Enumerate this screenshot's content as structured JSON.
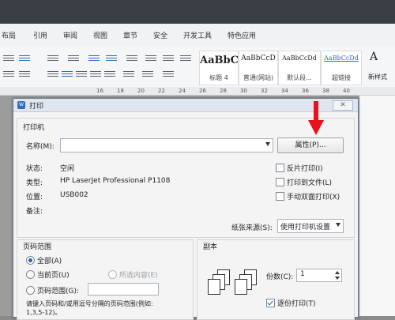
{
  "ribbon_tabs": [
    "布局",
    "引用",
    "审阅",
    "视图",
    "章节",
    "安全",
    "开发工具",
    "特色应用"
  ],
  "style_gallery": [
    {
      "sample": "AaBbC",
      "name": "标题 4"
    },
    {
      "sample": "AaBbCcD",
      "name": "普通(网站)"
    },
    {
      "sample": "AaBbCcDd",
      "name": "默认段..."
    },
    {
      "sample": "AaBbCcDd",
      "name": "超链接"
    }
  ],
  "new_style_label": "新样式",
  "ruler_ticks": [
    "16",
    "18",
    "20",
    "22",
    "24",
    "26",
    "28",
    "30",
    "32",
    "34",
    "36",
    "38",
    "40"
  ],
  "dialog": {
    "title": "打印",
    "close_label": "✕",
    "printer": {
      "group_title": "打印机",
      "name_label": "名称(M):",
      "name_value": "",
      "properties_button": "属性(P)...",
      "status_label": "状态:",
      "status_value": "空闲",
      "type_label": "类型:",
      "type_value": "HP LaserJet Professional P1108",
      "location_label": "位置:",
      "location_value": "USB002",
      "comment_label": "备注:",
      "comment_value": "",
      "reverse_print": "反片打印(I)",
      "print_to_file": "打印到文件(L)",
      "manual_duplex": "手动双面打印(X)",
      "paper_source_label": "纸张来源(S):",
      "paper_source_value": "使用打印机设置"
    },
    "page_range": {
      "group_title": "页码范围",
      "all": "全部(A)",
      "current_page": "当前页(U)",
      "selection": "所选内容(E)",
      "pages": "页码范围(G):",
      "pages_value": "",
      "hint": "请键入页码和/或用逗号分隔的页码范围(例如:",
      "hint_example": "1,3,5-12)。"
    },
    "copies": {
      "group_title": "副本",
      "count_label": "份数(C):",
      "count_value": "1",
      "collate": "逐份打印(T)"
    }
  },
  "colors": {
    "accent": "#2d5da8",
    "annotation_arrow": "#e8111c",
    "titlebar": "#dfe6ef"
  }
}
